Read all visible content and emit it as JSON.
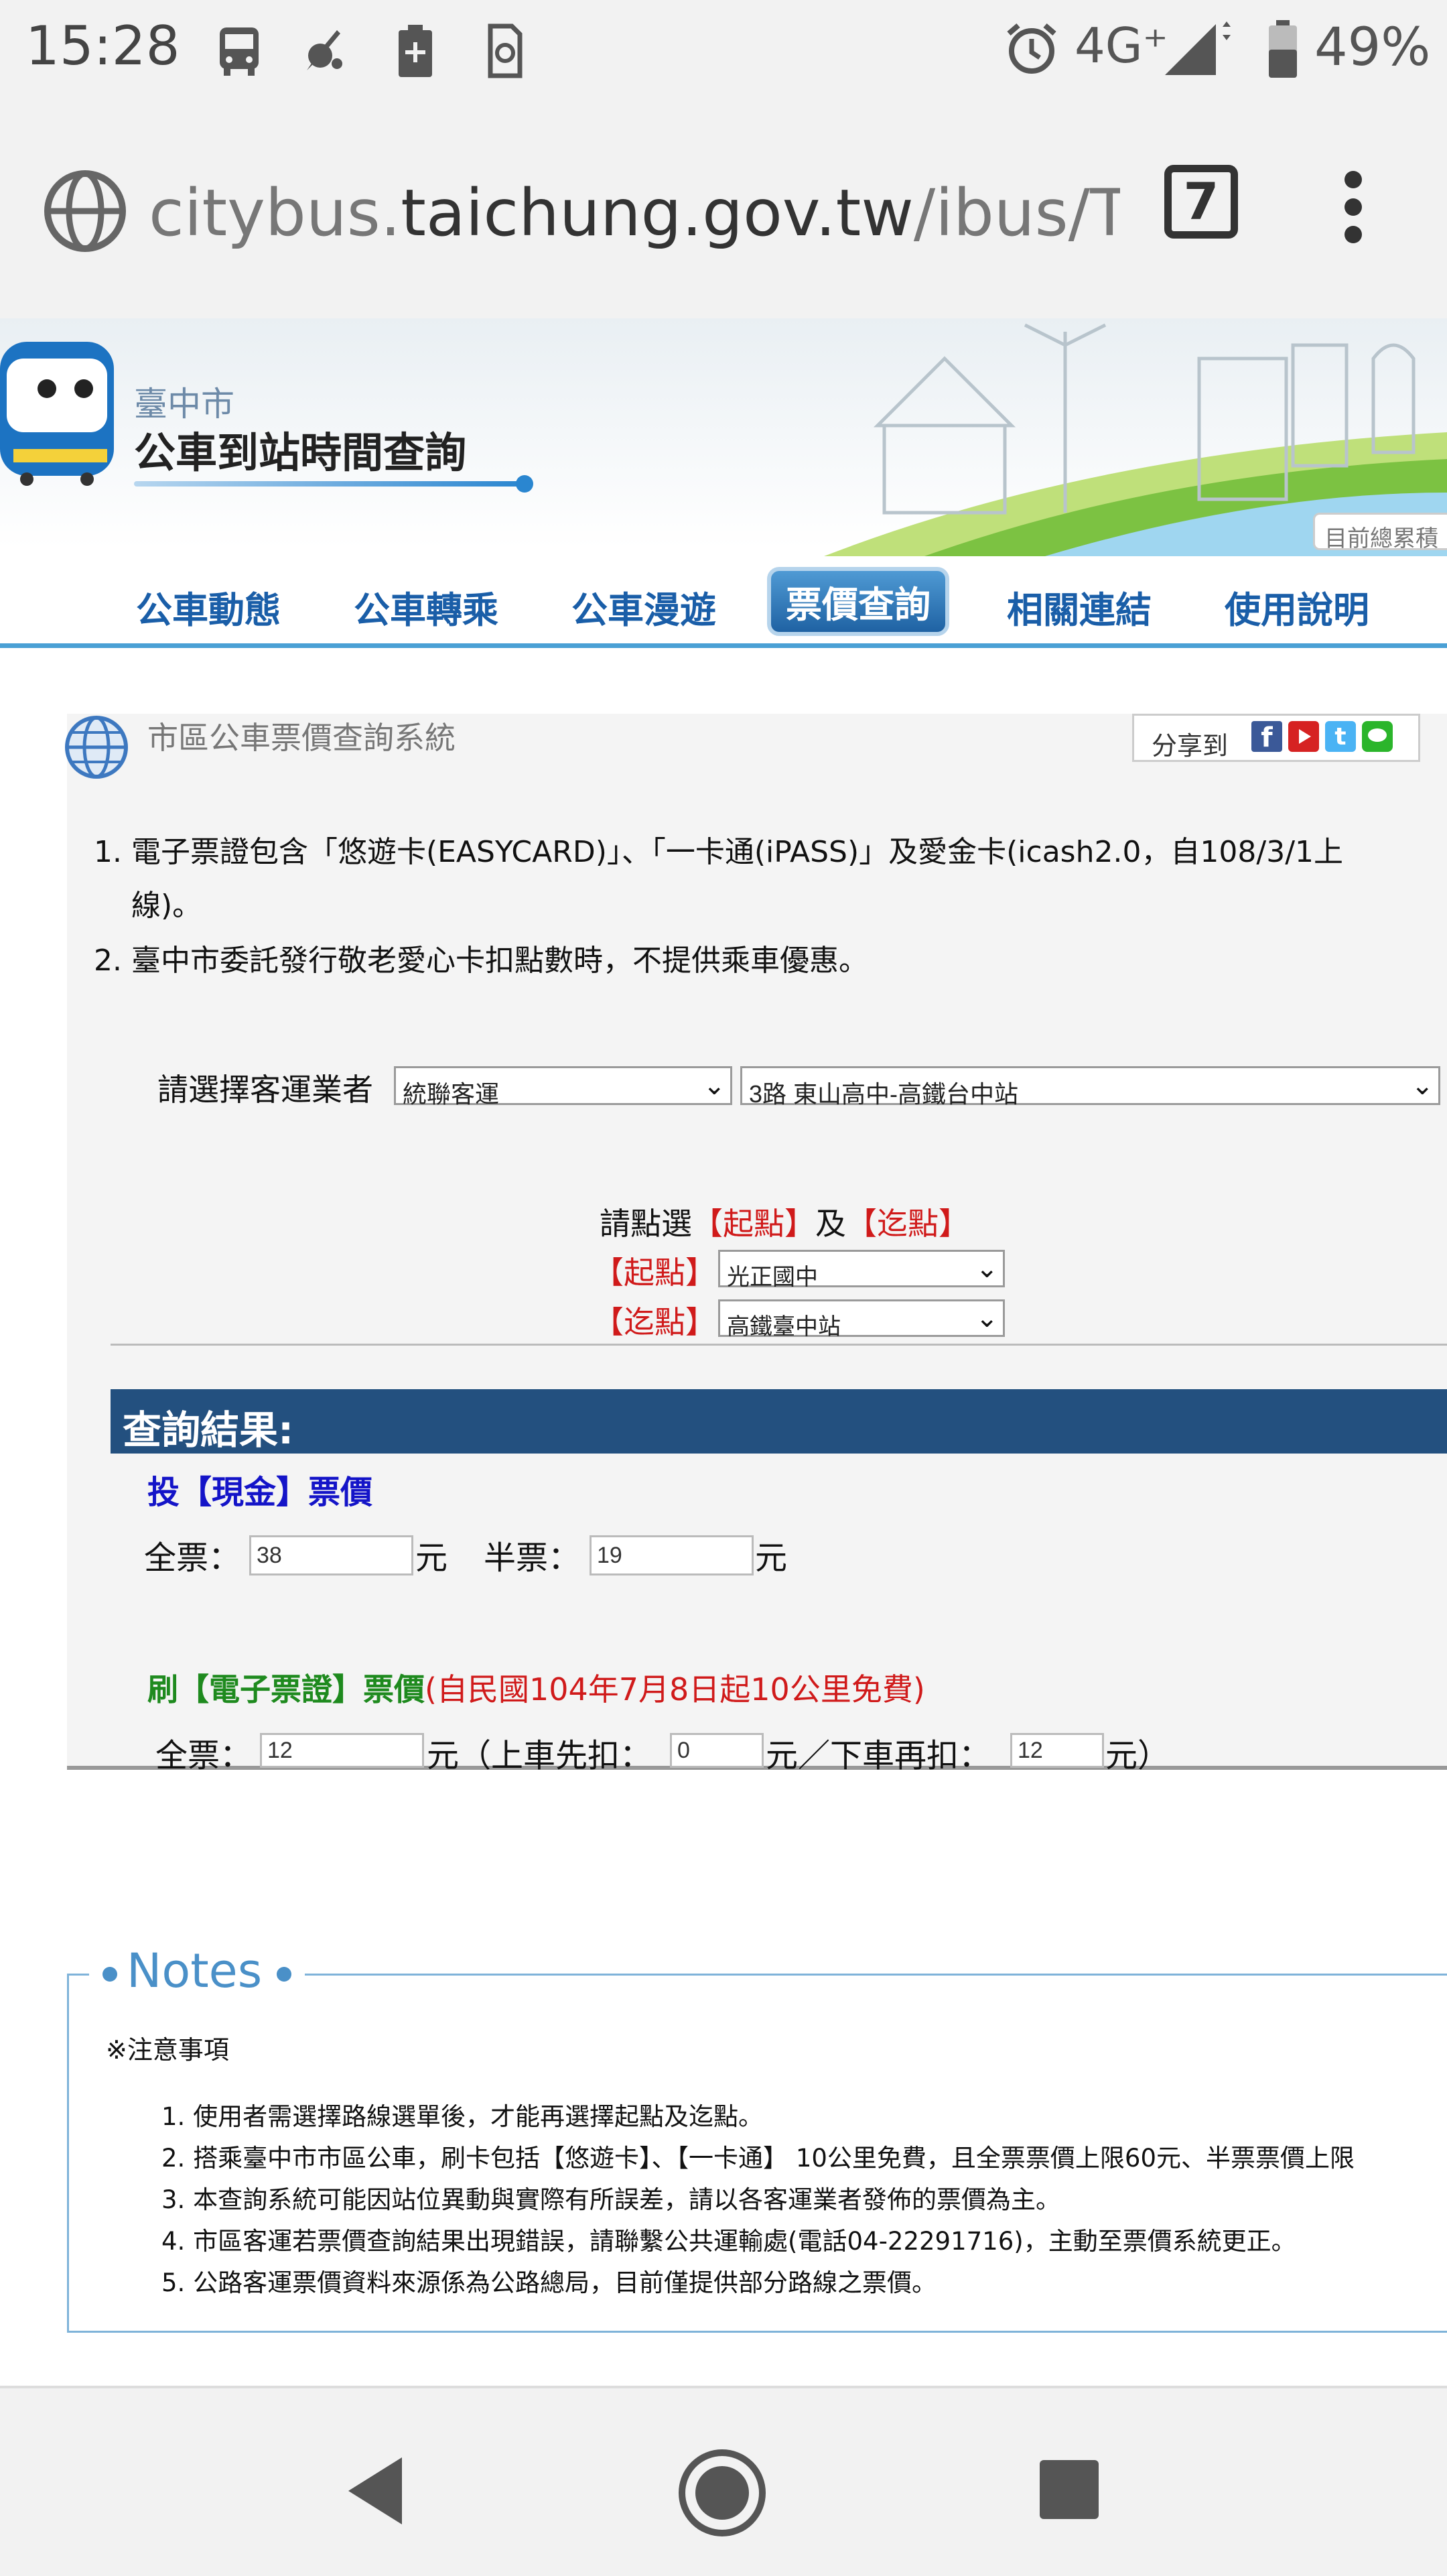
{
  "status": {
    "time": "15:28",
    "network": "4G⁺",
    "battery": "49%"
  },
  "browser": {
    "url_prefix": "citybus.",
    "url_domain": "taichung.gov.tw",
    "url_path": "/ibus/Tick",
    "tab_count": "7"
  },
  "site": {
    "city": "臺中市",
    "title": "公車到站時間查詢",
    "counter_label": "目前總累積",
    "nav": [
      "公車動態",
      "公車轉乘",
      "公車漫遊",
      "票價查詢",
      "相關連結",
      "使用說明"
    ]
  },
  "panel": {
    "title": "市區公車票價查詢系統",
    "share_label": "分享到",
    "notes": [
      "1. 電子票證包含「悠遊卡(EASYCARD)」、「一卡通(iPASS)」及愛金卡(icash2.0，自108/3/1上",
      "線)。",
      "2. 臺中市委託發行敬老愛心卡扣點數時，不提供乘車優惠。"
    ],
    "operator_label": "請選擇客運業者",
    "operator_value": "統聯客運",
    "route_value": "3路 東山高中-高鐵台中站",
    "pick_text_1": "請點選",
    "pick_start": "【起點】",
    "pick_and": "及",
    "pick_end": "【迄點】",
    "start_label": "【起點】",
    "start_value": "光正國中",
    "end_label": "【迄點】",
    "end_value": "高鐵臺中站",
    "results_title": "查詢結果:",
    "cash_title": "投【現金】票價",
    "full_label": "全票：",
    "full_cash": "38",
    "yuan": "元",
    "half_label": "半票：",
    "half_cash": "19",
    "card_title": "刷【電子票證】票價",
    "card_note": "(自民國104年7月8日起10公里免費)",
    "card_full_label": "全票：",
    "card_full": "12",
    "card_mid": "元（上車先扣：",
    "card_board": "0",
    "card_mid2": "元／下車再扣：",
    "card_alight": "12",
    "card_end": "元）"
  },
  "notes": {
    "heading": "Notes",
    "caption": "※注意事項",
    "items": [
      "1. 使用者需選擇路線選單後，才能再選擇起點及迄點。",
      "2. 搭乘臺中市市區公車，刷卡包括【悠遊卡】、【一卡通】 10公里免費，且全票票價上限60元、半票票價上限",
      "3. 本查詢系統可能因站位異動與實際有所誤差，請以各客運業者發佈的票價為主。",
      "4. 市區客運若票價查詢結果出現錯誤，請聯繫公共運輸處(電話04-22291716)，主動至票價系統更正。",
      "5. 公路客運票價資料來源係為公路總局，目前僅提供部分路線之票價。"
    ]
  },
  "colors": {
    "nav_text": "#1a5ea8",
    "results_bar": "#23507f",
    "cash_title": "#1414c8",
    "card_title": "#1e8a1e",
    "red": "#d01a1a"
  }
}
